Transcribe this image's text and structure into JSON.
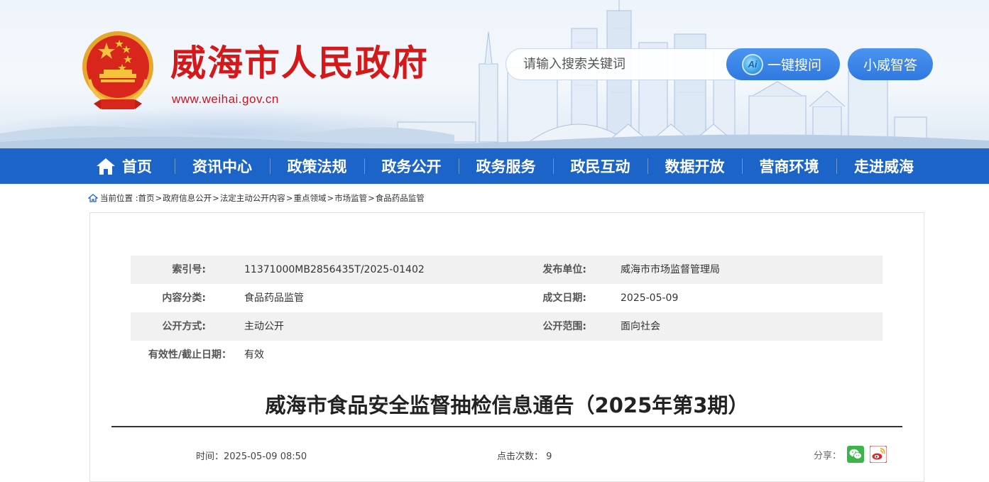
{
  "header": {
    "site_title": "威海市人民政府",
    "site_url": "www.weihai.gov.cn",
    "search": {
      "placeholder": "请输入搜索关键词",
      "ai_badge": "Ai",
      "ai_button_label": "一键搜问"
    },
    "assistant_button_label": "小威智答"
  },
  "nav": {
    "items": [
      "首页",
      "资讯中心",
      "政策法规",
      "政务公开",
      "政务服务",
      "政民互动",
      "数据开放",
      "营商环境",
      "走进威海"
    ]
  },
  "breadcrumb": {
    "prefix": "当前位置 :",
    "items": [
      "首页",
      "政府信息公开",
      "法定主动公开内容",
      "重点领域",
      "市场监管",
      "食品药品监管"
    ]
  },
  "info": {
    "index_label": "索引号:",
    "index_value": "11371000MB2856435T/2025-01402",
    "publisher_label": "发布单位:",
    "publisher_value": "威海市市场监督管理局",
    "category_label": "内容分类:",
    "category_value": "食品药品监管",
    "date_label": "成文日期:",
    "date_value": "2025-05-09",
    "method_label": "公开方式:",
    "method_value": "主动公开",
    "scope_label": "公开范围:",
    "scope_value": "面向社会",
    "validity_label": "有效性/截止日期：",
    "validity_value": "有效"
  },
  "article": {
    "title": "威海市食品安全监督抽检信息通告（2025年第3期）",
    "time_label": "时间：",
    "time_value": "2025-05-09 08:50",
    "clicks_label": "点击次数：",
    "clicks_value": "9",
    "share_label": "分享："
  },
  "colors": {
    "brand_red": "#d5181a",
    "nav_blue": "#1d64c8",
    "button_blue": "#2f78e0",
    "wechat_green": "#3bb54a",
    "weibo_red": "#d52b2b"
  }
}
